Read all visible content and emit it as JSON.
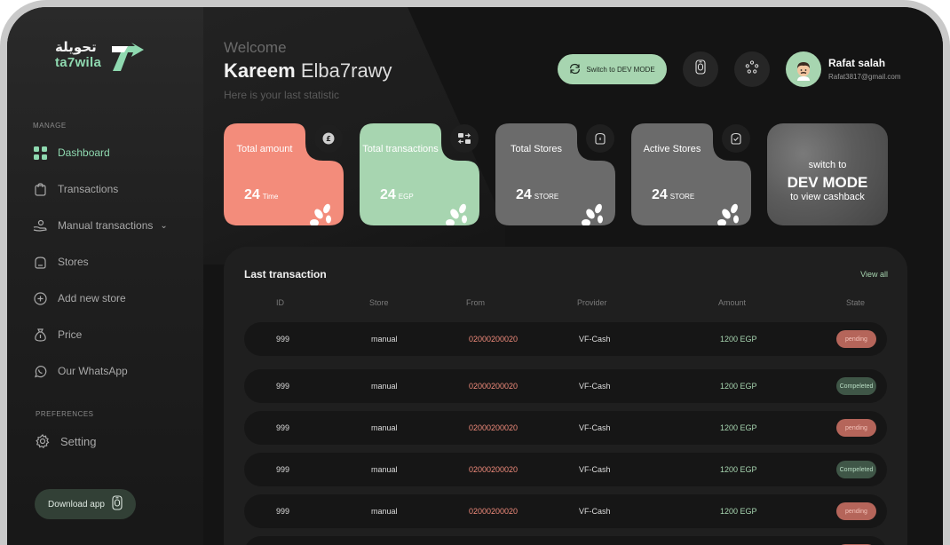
{
  "brand": {
    "arabic_name": "تحويلة",
    "latin_name": "ta7wila",
    "accent": "#8fd9b0"
  },
  "sidebar": {
    "manage_label": "MANAGE",
    "items": [
      {
        "label": "Dashboard",
        "icon": "dashboard-grid-icon",
        "active": true
      },
      {
        "label": "Transactions",
        "icon": "bag-icon"
      },
      {
        "label": "Manual transactions",
        "icon": "hand-coin-icon",
        "has_dropdown": true
      },
      {
        "label": "Stores",
        "icon": "store-icon"
      },
      {
        "label": "Add new store",
        "icon": "add-circle-icon"
      },
      {
        "label": "Price",
        "icon": "money-bag-icon"
      },
      {
        "label": "Our WhatsApp",
        "icon": "whatsapp-icon"
      }
    ],
    "preferences_label": "PREFERENCES",
    "setting_label": "Setting",
    "download_label": "Download app"
  },
  "header": {
    "welcome": "Welcome",
    "first_name": "Kareem ",
    "last_name": "Elba7rawy",
    "subtitle": "Here is your last statistic",
    "dev_button": "Switch to DEV MODE",
    "profile_name": "Rafat salah",
    "profile_email": "Rafat3817@gmail.com"
  },
  "cards": [
    {
      "title": "Total amount",
      "value": "24",
      "unit": "Time",
      "color": "#f38c7b",
      "text_color": "#ffffff"
    },
    {
      "title": "Total transactions",
      "value": "24",
      "unit": "EGP",
      "color": "#a7d5b0",
      "text_color": "#ffffff"
    },
    {
      "title": "Total Stores",
      "value": "24",
      "unit": "STORE",
      "color": "#6b6b6b",
      "text_color": "#ffffff"
    },
    {
      "title": "Active Stores",
      "value": "24",
      "unit": "STORE",
      "color": "#6b6b6b",
      "text_color": "#ffffff"
    }
  ],
  "promo": {
    "line1": "switch to",
    "line2": "DEV MODE",
    "line3": "to view cashback"
  },
  "table": {
    "title": "Last transaction",
    "view_all": "View all",
    "headers": [
      "ID",
      "Store",
      "From",
      "Provider",
      "Amount",
      "State"
    ],
    "rows": [
      {
        "id": "999",
        "store": "manual",
        "from": "02000200020",
        "provider": "VF-Cash",
        "amount": "1200 EGP",
        "state": "pending"
      },
      {
        "id": "999",
        "store": "manual",
        "from": "02000200020",
        "provider": "VF-Cash",
        "amount": "1200 EGP",
        "state": "Compeleted"
      },
      {
        "id": "999",
        "store": "manual",
        "from": "02000200020",
        "provider": "VF-Cash",
        "amount": "1200 EGP",
        "state": "pending"
      },
      {
        "id": "999",
        "store": "manual",
        "from": "02000200020",
        "provider": "VF-Cash",
        "amount": "1200 EGP",
        "state": "Compeleted"
      },
      {
        "id": "999",
        "store": "manual",
        "from": "02000200020",
        "provider": "VF-Cash",
        "amount": "1200 EGP",
        "state": "pending"
      }
    ]
  }
}
